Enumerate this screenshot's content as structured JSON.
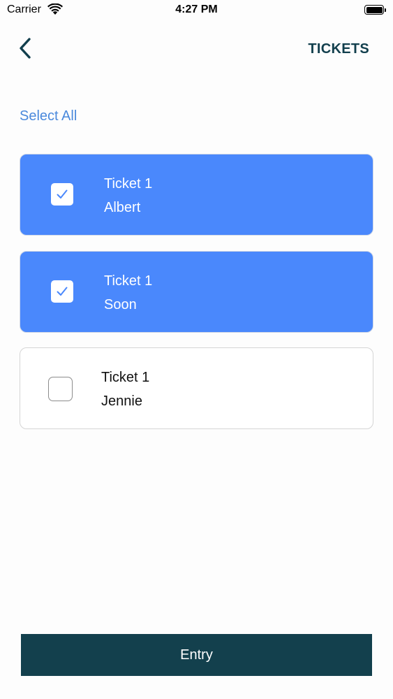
{
  "status_bar": {
    "carrier": "Carrier",
    "time": "4:27 PM",
    "wifi_icon": "wifi-icon",
    "battery_icon": "battery-icon"
  },
  "nav": {
    "back_icon": "chevron-left-icon",
    "title": "TICKETS",
    "title_color": "#123f4d"
  },
  "select_all_label": "Select All",
  "accent_color": "#4a88fc",
  "tickets": [
    {
      "title": "Ticket 1",
      "name": "Albert",
      "selected": true
    },
    {
      "title": "Ticket 1",
      "name": "Soon",
      "selected": true
    },
    {
      "title": "Ticket 1",
      "name": "Jennie",
      "selected": false
    }
  ],
  "entry_button": {
    "label": "Entry",
    "color": "#13404d"
  }
}
